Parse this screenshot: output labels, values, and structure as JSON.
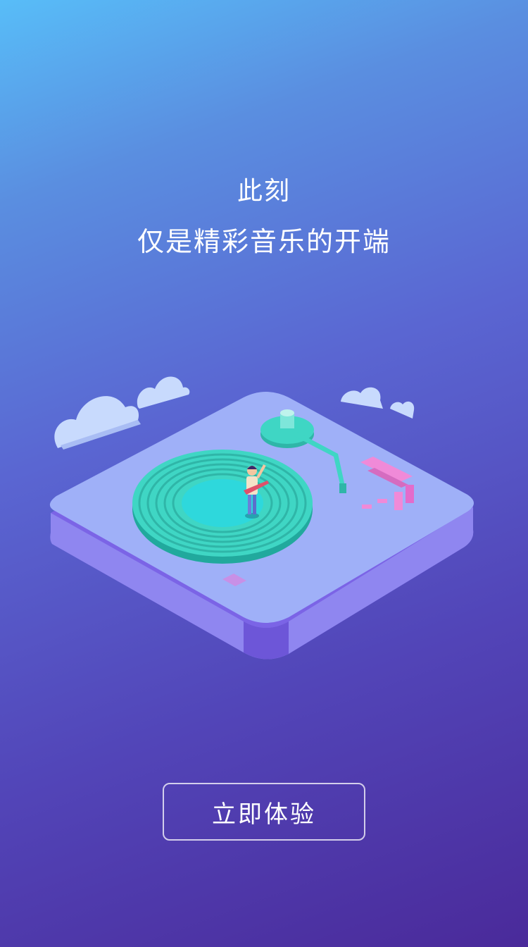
{
  "intro": {
    "headline_line1": "此刻",
    "headline_line2": "仅是精彩音乐的开端"
  },
  "illustration": {
    "icon": "turntable-illustration",
    "colors": {
      "platform_top": "#9fb0f8",
      "platform_side": "#7b64e6",
      "record": "#3fd6c4",
      "cloud": "#cfe0ff",
      "accent_pink": "#f08ad8"
    }
  },
  "cta": {
    "label": "立即体验"
  },
  "theme": {
    "gradient_top": "#58bdf8",
    "gradient_bottom": "#4a2a9a"
  }
}
